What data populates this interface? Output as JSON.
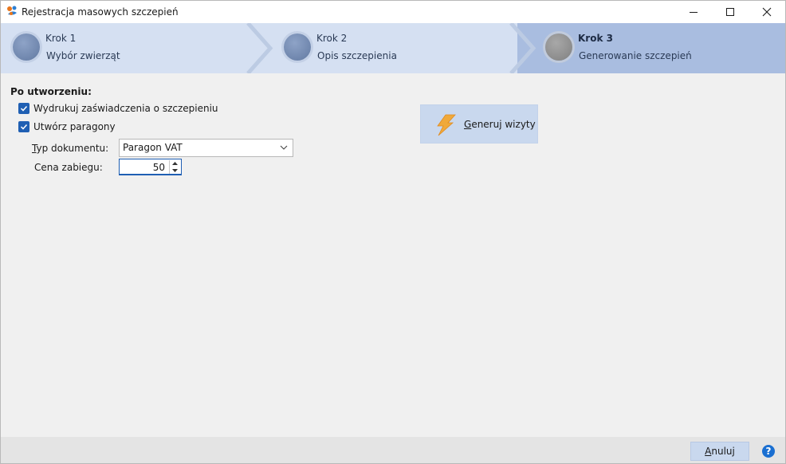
{
  "window": {
    "title": "Rejestracja masowych szczepień",
    "controls": {
      "minimize": "minimize-icon",
      "maximize": "maximize-icon",
      "close": "close-icon"
    }
  },
  "steps": [
    {
      "num": "Krok 1",
      "desc": "Wybór zwierząt",
      "active": false
    },
    {
      "num": "Krok 2",
      "desc": "Opis szczepienia",
      "active": false
    },
    {
      "num": "Krok 3",
      "desc": "Generowanie szczepień",
      "active": true
    }
  ],
  "after_creation": {
    "title": "Po utworzeniu:",
    "print_certificates": {
      "label": "Wydrukuj zaświadczenia o szczepieniu",
      "checked": true
    },
    "create_receipts": {
      "label": "Utwórz paragony",
      "checked": true
    },
    "doc_type": {
      "label_prefix": "T",
      "label_rest": "yp dokumentu:",
      "value": "Paragon VAT"
    },
    "price": {
      "label": "Cena zabiegu:",
      "value": "50"
    }
  },
  "generate": {
    "label_prefix": "G",
    "label_rest": "eneruj wizyty",
    "icon": "lightning-icon"
  },
  "footer": {
    "cancel_prefix": "A",
    "cancel_rest": "nuluj",
    "help": "?"
  },
  "colors": {
    "accent": "#1f5fb3",
    "step_bg": "#d5e0f2",
    "step_active_bg": "#a9bde0",
    "button_bg": "#c9d8ee"
  }
}
